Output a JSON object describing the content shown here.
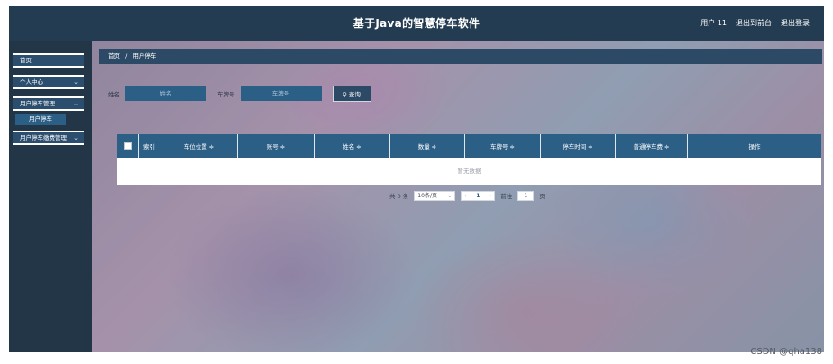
{
  "header": {
    "title": "基于Java的智慧停车软件",
    "user": "用户 11",
    "to_backend": "退出到前台",
    "logout": "退出登录"
  },
  "sidebar": {
    "items": [
      {
        "label": "首页",
        "chevron": ""
      },
      {
        "label": "个人中心",
        "chevron": "⌄"
      },
      {
        "label": "用户停车管理",
        "chevron": "⌄"
      },
      {
        "label": "用户停车缴费管理",
        "chevron": "⌄"
      }
    ],
    "sub_items": [
      {
        "label": "用户停车"
      }
    ]
  },
  "breadcrumb": {
    "home": "首页",
    "separator": "/",
    "current": "用户停车"
  },
  "search": {
    "name_label": "姓名",
    "name_placeholder": "姓名",
    "plate_label": "车牌号",
    "plate_placeholder": "车牌号",
    "button": "查询",
    "button_icon": "search-icon"
  },
  "table": {
    "columns": [
      "索引",
      "车位位置 ≑",
      "账号 ≑",
      "姓名 ≑",
      "数量 ≑",
      "车牌号 ≑",
      "停车时间 ≑",
      "普通停车费 ≑",
      "操作"
    ],
    "empty_text": "暂无数据"
  },
  "pagination": {
    "total": "共 0 条",
    "page_size": "10条/页",
    "prev": "‹",
    "current_page": "1",
    "next": "›",
    "goto_label": "前往",
    "goto_value": "1",
    "page_unit": "页"
  },
  "watermark": "CSDN @qha138",
  "colors": {
    "header_bg": "#243c52",
    "sidebar_bg": "#233647",
    "accent": "#2c5f86"
  }
}
